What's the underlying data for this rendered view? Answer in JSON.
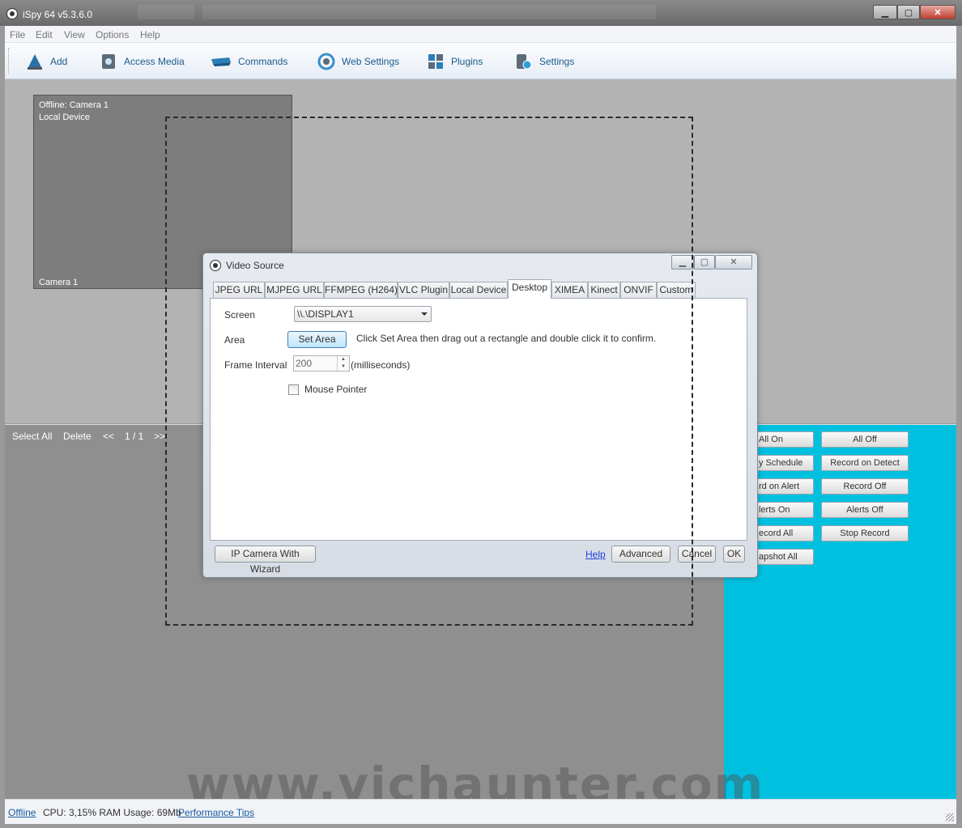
{
  "window": {
    "title": "iSpy 64 v5.3.6.0",
    "min": "▁",
    "max": "▢",
    "close": "✕"
  },
  "menu": [
    "File",
    "Edit",
    "View",
    "Options",
    "Help"
  ],
  "toolbar": [
    "Add",
    "Access Media",
    "Commands",
    "Web Settings",
    "Plugins",
    "Settings"
  ],
  "camera_tile": {
    "status": "Offline: Camera 1",
    "source": "Local Device",
    "name": "Camera 1"
  },
  "lower_panel": {
    "select_all": "Select All",
    "delete": "Delete",
    "prev": "<<",
    "page": "1 / 1",
    "next": ">>"
  },
  "right_buttons": {
    "left": [
      "All On",
      "y Schedule",
      "rd on Alert",
      "lerts On",
      "ecord All",
      "apshot All"
    ],
    "right": [
      "All Off",
      "Record on Detect",
      "Record Off",
      "Alerts Off",
      "Stop Record"
    ]
  },
  "watermark": "www.vichaunter.com",
  "status": {
    "offline": "Offline",
    "usage": "CPU: 3,15% RAM Usage: 69Mb",
    "tips": "Performance Tips"
  },
  "dialog": {
    "title": "Video Source",
    "tabs": [
      "JPEG URL",
      "MJPEG URL",
      "FFMPEG (H264)",
      "VLC Plugin",
      "Local Device",
      "Desktop",
      "XIMEA",
      "Kinect",
      "ONVIF",
      "Custom"
    ],
    "active_tab": "Desktop",
    "screen_label": "Screen",
    "screen_value": "\\\\.\\DISPLAY1",
    "area_label": "Area",
    "set_area": "Set Area",
    "area_hint": "Click Set Area then drag out a rectangle and double click it to confirm.",
    "frame_label": "Frame Interval",
    "frame_value": "200",
    "frame_unit": "(milliseconds)",
    "mouse_pointer": "Mouse Pointer",
    "mouse_pointer_checked": false,
    "wizard": "IP Camera With Wizard",
    "help": "Help",
    "advanced": "Advanced",
    "cancel": "Cancel",
    "ok": "OK"
  },
  "colors": {
    "accent": "#00c0e0",
    "link": "#1a5aa0"
  }
}
